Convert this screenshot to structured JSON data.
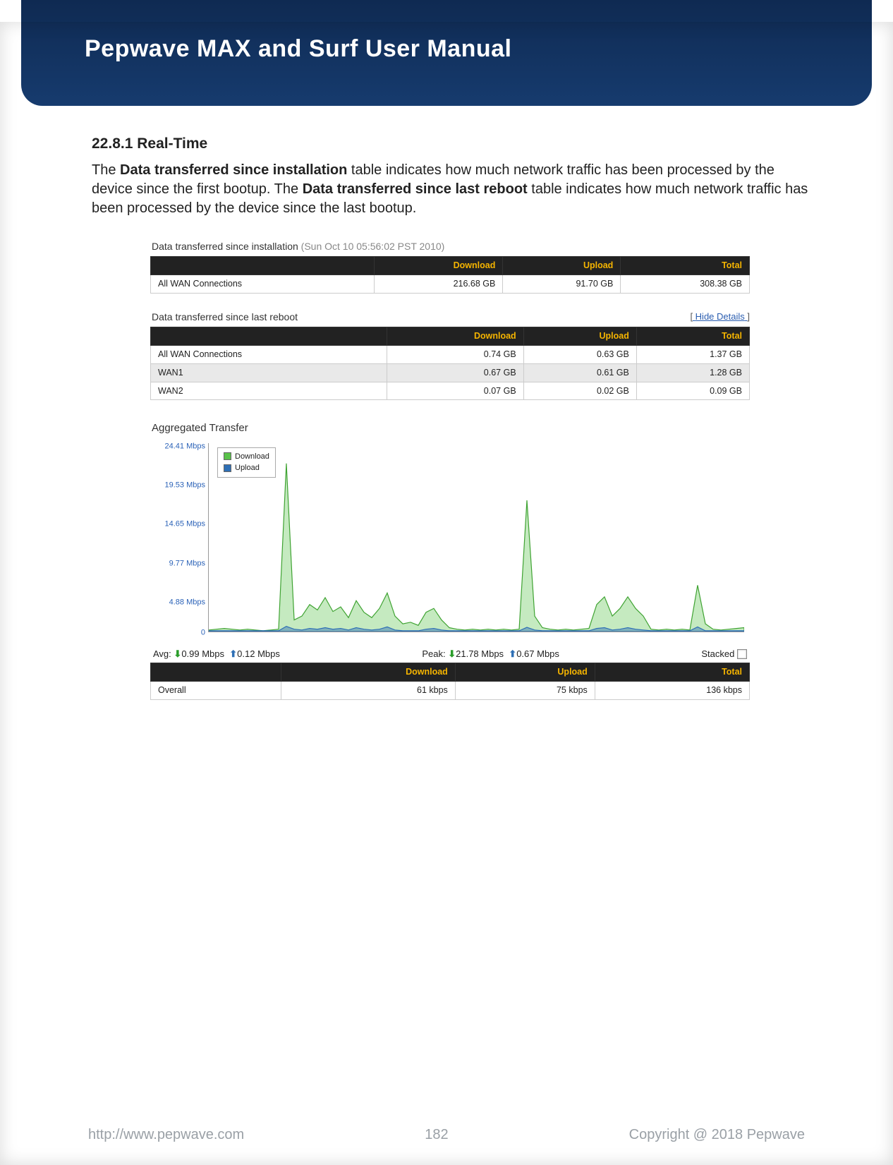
{
  "header": {
    "title": "Pepwave MAX and Surf User Manual"
  },
  "section": {
    "number": "22.8.1 Real-Time",
    "text_parts": {
      "p1": "The ",
      "b1": "Data transferred since installation",
      "p2": " table indicates how much network traffic has been processed by the device since the first bootup. The ",
      "b2": "Data transferred since last reboot",
      "p3": " table indicates how much network traffic has been processed by the device since the last bootup."
    }
  },
  "table1": {
    "caption_main": "Data transferred since installation ",
    "caption_dim": "(Sun Oct 10 05:56:02 PST 2010)",
    "headers": [
      "",
      "Download",
      "Upload",
      "Total"
    ],
    "rows": [
      {
        "label": "All WAN Connections",
        "download": "216.68 GB",
        "upload": "91.70 GB",
        "total": "308.38 GB"
      }
    ]
  },
  "table2": {
    "caption": "Data transferred since last reboot",
    "hide_link": "Hide Details",
    "headers": [
      "",
      "Download",
      "Upload",
      "Total"
    ],
    "rows": [
      {
        "label": "All WAN Connections",
        "download": "0.74 GB",
        "upload": "0.63 GB",
        "total": "1.37 GB"
      },
      {
        "label": "WAN1",
        "download": "0.67 GB",
        "upload": "0.61 GB",
        "total": "1.28 GB"
      },
      {
        "label": "WAN2",
        "download": "0.07 GB",
        "upload": "0.02 GB",
        "total": "0.09 GB"
      }
    ]
  },
  "chart": {
    "title": "Aggregated Transfer",
    "legend": {
      "dl": "Download",
      "ul": "Upload"
    },
    "yticks": [
      "24.41 Mbps",
      "19.53 Mbps",
      "14.65 Mbps",
      "9.77 Mbps",
      "4.88 Mbps",
      "0"
    ],
    "stats": {
      "avg_label": "Avg:",
      "avg_dl": "0.99 Mbps",
      "avg_ul": "0.12 Mbps",
      "peak_label": "Peak:",
      "peak_dl": "21.78 Mbps",
      "peak_ul": "0.67 Mbps",
      "stacked_label": "Stacked"
    }
  },
  "table3": {
    "headers": [
      "",
      "Download",
      "Upload",
      "Total"
    ],
    "rows": [
      {
        "label": "Overall",
        "download": "61 kbps",
        "upload": "75 kbps",
        "total": "136 kbps"
      }
    ]
  },
  "footer": {
    "url": "http://www.pepwave.com",
    "page": "182",
    "copyright": "Copyright @ 2018 Pepwave"
  },
  "chart_data": {
    "type": "area",
    "title": "Aggregated Transfer",
    "ylabel": "Mbps",
    "ylim": [
      0,
      24.41
    ],
    "yticks": [
      0,
      4.88,
      9.77,
      14.65,
      19.53,
      24.41
    ],
    "series": [
      {
        "name": "Download",
        "color": "#59c24a",
        "values": [
          0.2,
          0.3,
          0.4,
          0.3,
          0.2,
          0.3,
          0.2,
          0.1,
          0.2,
          0.3,
          21.78,
          1.5,
          2.0,
          3.5,
          2.8,
          4.4,
          2.6,
          3.2,
          1.8,
          4.0,
          2.5,
          1.8,
          3.0,
          5.0,
          2.0,
          1.0,
          1.2,
          0.8,
          2.5,
          3.0,
          1.5,
          0.5,
          0.3,
          0.2,
          0.3,
          0.2,
          0.3,
          0.2,
          0.3,
          0.2,
          0.3,
          17.0,
          2.0,
          0.5,
          0.3,
          0.2,
          0.3,
          0.2,
          0.3,
          0.4,
          3.5,
          4.5,
          2.0,
          3.0,
          4.5,
          3.0,
          2.0,
          0.3,
          0.2,
          0.3,
          0.2,
          0.3,
          0.2,
          6.0,
          1.0,
          0.3,
          0.2,
          0.3,
          0.4,
          0.5
        ]
      },
      {
        "name": "Upload",
        "color": "#2e6fb5",
        "values": [
          0.1,
          0.1,
          0.1,
          0.1,
          0.1,
          0.1,
          0.1,
          0.1,
          0.1,
          0.1,
          0.67,
          0.3,
          0.2,
          0.4,
          0.3,
          0.5,
          0.3,
          0.4,
          0.2,
          0.5,
          0.3,
          0.2,
          0.3,
          0.6,
          0.2,
          0.1,
          0.1,
          0.1,
          0.3,
          0.4,
          0.2,
          0.1,
          0.1,
          0.1,
          0.1,
          0.1,
          0.1,
          0.1,
          0.1,
          0.1,
          0.1,
          0.55,
          0.2,
          0.1,
          0.1,
          0.1,
          0.1,
          0.1,
          0.1,
          0.1,
          0.4,
          0.5,
          0.2,
          0.3,
          0.5,
          0.3,
          0.2,
          0.1,
          0.1,
          0.1,
          0.1,
          0.1,
          0.1,
          0.6,
          0.1,
          0.1,
          0.1,
          0.1,
          0.1,
          0.1
        ]
      }
    ]
  }
}
